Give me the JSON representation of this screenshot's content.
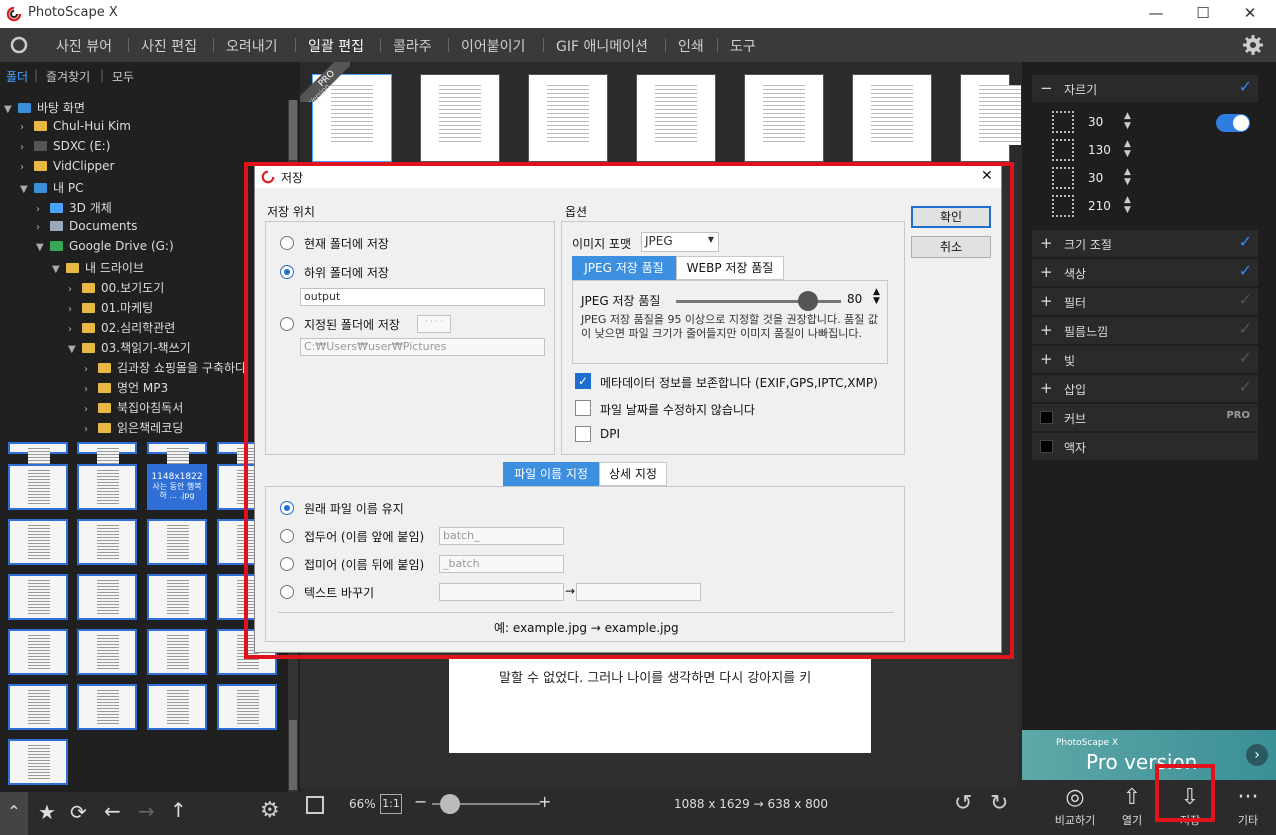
{
  "app": {
    "title": "PhotoScape X"
  },
  "menu": {
    "tabs": [
      "사진 뷰어",
      "사진 편집",
      "오려내기",
      "일괄 편집",
      "콜라주",
      "이어붙이기",
      "GIF 애니메이션",
      "인쇄",
      "도구"
    ]
  },
  "left": {
    "tabs": [
      "폴더",
      "즐겨찾기",
      "모두"
    ],
    "tree": [
      "바탕 화면",
      "Chul-Hui Kim",
      "SDXC (E:)",
      "VidClipper",
      "내 PC",
      "3D 개체",
      "Documents",
      "Google Drive (G:)",
      "내 드라이브",
      "00.보기도기",
      "01.마케팅",
      "02.심리학관련",
      "03.책읽기-책쓰기",
      "김과장 쇼핑몰을 구축하다",
      "명언 MP3",
      "북집아침독서",
      "읽은책레코딩"
    ],
    "selected_thumb": {
      "size": "1148x1822",
      "name": "사는 동안 행복하 ... .jpg"
    }
  },
  "filmstrip": {
    "pro_badge": "PRO",
    "pro_sub": "Version"
  },
  "preview": {
    "text": "말할 수 없었다. 그러나 나이를 생각하면 다시 강아지를 키"
  },
  "center_bottom": {
    "zoom": "66%",
    "ratio": "1:1",
    "dimensions": "1088 x 1629 → 638 x 800"
  },
  "right": {
    "crop_label": "자르기",
    "crop_values": [
      "30",
      "130",
      "30",
      "210"
    ],
    "rows": [
      "크기 조절",
      "색상",
      "필터",
      "필름느낌",
      "빛",
      "삽입",
      "커브",
      "액자"
    ],
    "pro_tag": "PRO",
    "promo_small": "PhotoScape X",
    "promo_big": "Pro version"
  },
  "bottom_icons": {
    "compare": "비교하기",
    "open": "열기",
    "save": "저장",
    "more": "기타"
  },
  "dialog": {
    "title": "저장",
    "save_location": "저장 위치",
    "opt_current": "현재 폴더에 저장",
    "opt_sub": "하위 폴더에 저장",
    "sub_value": "output",
    "opt_specified": "지정된 폴더에 저장",
    "browse": "· · · ·",
    "specified_path": "C:₩Users₩user₩Pictures",
    "options": "옵션",
    "image_format_label": "이미지 포맷",
    "image_format": "JPEG",
    "tab_jpeg": "JPEG 저장 품질",
    "tab_webp": "WEBP 저장 품질",
    "quality_label": "JPEG 저장 품질",
    "quality": 80,
    "quality_note": "JPEG 저장 품질을 95 이상으로 지정할 것을 권장합니다. 품질 값이 낮으면 파일 크기가 줄어들지만 이미지 품질이 나빠집니다.",
    "cb_meta": "메타데이터 정보를 보존합니다 (EXIF,GPS,IPTC,XMP)",
    "cb_date": "파일 날짜를 수정하지 않습니다",
    "cb_dpi": "DPI",
    "ok": "확인",
    "cancel": "취소",
    "tab_filename": "파일 이름 지정",
    "tab_detail": "상세 지정",
    "fn_keep": "원래 파일 이름 유지",
    "fn_prefix": "접두어 (이름 앞에 붙임)",
    "prefix_value": "batch_",
    "fn_suffix": "접미어 (이름 뒤에 붙임)",
    "suffix_value": "_batch",
    "fn_replace": "텍스트 바꾸기",
    "arrow": "→",
    "example": "예: example.jpg → example.jpg"
  }
}
